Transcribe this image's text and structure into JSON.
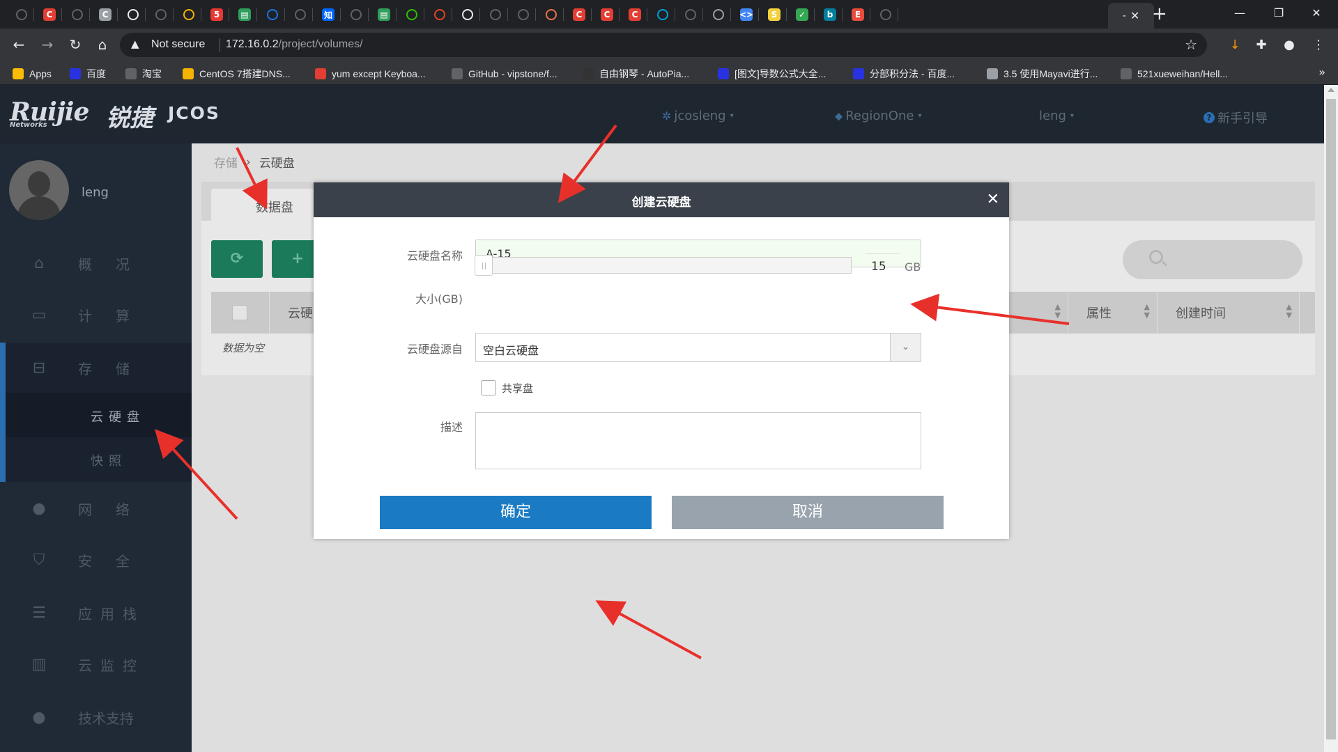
{
  "browser": {
    "tabs": [
      {
        "icon": "globe-icon",
        "color": "#5f6368",
        "glyph": ""
      },
      {
        "icon": "csdn-icon",
        "color": "#e33e33",
        "glyph": "C"
      },
      {
        "icon": "globe-icon",
        "color": "#5f6368",
        "glyph": ""
      },
      {
        "icon": "c-gray-icon",
        "color": "#9aa0a6",
        "glyph": "C"
      },
      {
        "icon": "puzzle-icon",
        "color": "#e8eaed",
        "glyph": ""
      },
      {
        "icon": "globe-icon",
        "color": "#5f6368",
        "glyph": ""
      },
      {
        "icon": "emoji-icon",
        "color": "#f4b400",
        "glyph": ""
      },
      {
        "icon": "five-icon",
        "color": "#e53935",
        "glyph": "5"
      },
      {
        "icon": "gitee-icon",
        "color": "#2e9e5b",
        "glyph": "▤"
      },
      {
        "icon": "search-icon",
        "color": "#1a73e8",
        "glyph": ""
      },
      {
        "icon": "github-icon",
        "color": "#5f6368",
        "glyph": ""
      },
      {
        "icon": "zhihu-icon",
        "color": "#0066ff",
        "glyph": "知"
      },
      {
        "icon": "github-icon",
        "color": "#5f6368",
        "glyph": ""
      },
      {
        "icon": "gitee-icon",
        "color": "#2e9e5b",
        "glyph": "▤"
      },
      {
        "icon": "wechat-icon",
        "color": "#2dc100",
        "glyph": ""
      },
      {
        "icon": "gitlab-icon",
        "color": "#e24329",
        "glyph": ""
      },
      {
        "icon": "panda-icon",
        "color": "#e8eaed",
        "glyph": ""
      },
      {
        "icon": "github-icon",
        "color": "#5f6368",
        "glyph": ""
      },
      {
        "icon": "globe-icon",
        "color": "#5f6368",
        "glyph": ""
      },
      {
        "icon": "fox-icon",
        "color": "#e8734a",
        "glyph": ""
      },
      {
        "icon": "csdn-icon",
        "color": "#e33e33",
        "glyph": "C"
      },
      {
        "icon": "csdn-icon",
        "color": "#e33e33",
        "glyph": "C"
      },
      {
        "icon": "csdn-icon",
        "color": "#e33e33",
        "glyph": "C"
      },
      {
        "icon": "bilibili-icon",
        "color": "#00a1d6",
        "glyph": ""
      },
      {
        "icon": "globe-icon",
        "color": "#5f6368",
        "glyph": ""
      },
      {
        "icon": "settings-icon",
        "color": "#9aa0a6",
        "glyph": ""
      },
      {
        "icon": "code-icon",
        "color": "#4285f4",
        "glyph": "<>"
      },
      {
        "icon": "s-yellow-icon",
        "color": "#f4d03f",
        "glyph": "S"
      },
      {
        "icon": "check-icon",
        "color": "#34a853",
        "glyph": "✓"
      },
      {
        "icon": "bing-icon",
        "color": "#00809d",
        "glyph": "b"
      },
      {
        "icon": "e-icon",
        "color": "#e74c3c",
        "glyph": "E"
      },
      {
        "icon": "github-icon",
        "color": "#5f6368",
        "glyph": ""
      }
    ],
    "active_tab_label": "-",
    "address": {
      "security": "Not secure",
      "host": "172.16.0.2",
      "path": "/project/volumes/"
    },
    "bookmarks": [
      {
        "label": "Apps",
        "icon": "apps-icon",
        "color": "#fbbc04"
      },
      {
        "label": "百度",
        "icon": "baidu-icon",
        "color": "#2932e1"
      },
      {
        "label": "淘宝",
        "icon": "globe-icon",
        "color": "#5f6368"
      },
      {
        "label": "CentOS 7搭建DNS...",
        "icon": "centos-icon",
        "color": "#f4b400"
      },
      {
        "label": "yum except Keyboa...",
        "icon": "csdn-icon",
        "color": "#e33e33"
      },
      {
        "label": "GitHub - vipstone/f...",
        "icon": "github-icon",
        "color": "#5f6368"
      },
      {
        "label": "自由钢琴 - AutoPia...",
        "icon": "piano-icon",
        "color": "#333333"
      },
      {
        "label": "[图文]导数公式大全...",
        "icon": "baidu-icon",
        "color": "#2932e1"
      },
      {
        "label": "分部积分法 - 百度...",
        "icon": "baidu-icon",
        "color": "#2932e1"
      },
      {
        "label": "3.5 使用Mayavi进行...",
        "icon": "book-icon",
        "color": "#9aa0a6"
      },
      {
        "label": "521xueweihan/Hell...",
        "icon": "github-icon",
        "color": "#5f6368"
      }
    ]
  },
  "app": {
    "logo": {
      "brand": "Ruijie",
      "sub": "Networks",
      "cn": "锐捷",
      "product": "JCOS"
    },
    "header": {
      "project": "jcosleng",
      "region": "RegionOne",
      "user": "leng",
      "help": "新手引导"
    },
    "sidebar": {
      "username": "leng",
      "items": [
        {
          "label": "概况",
          "icon": "home-icon"
        },
        {
          "label": "计算",
          "icon": "monitor-icon"
        },
        {
          "label": "存储",
          "icon": "hdd-icon"
        },
        {
          "label": "网络",
          "icon": "globe-icon"
        },
        {
          "label": "安全",
          "icon": "shield-icon"
        },
        {
          "label": "应用栈",
          "icon": "stack-icon"
        },
        {
          "label": "云监控",
          "icon": "bar-chart-icon"
        },
        {
          "label": "技术支持",
          "icon": "chat-icon"
        }
      ],
      "sub_items": [
        {
          "label": "云硬盘"
        },
        {
          "label": "快照"
        }
      ]
    },
    "breadcrumb": {
      "parent": "存储",
      "current": "云硬盘"
    },
    "panel": {
      "tab": "数据盘",
      "columns": [
        "云硬",
        "属性",
        "创建时间"
      ],
      "empty": "数据为空"
    },
    "modal": {
      "title": "创建云硬盘",
      "name_label": "云硬盘名称",
      "name_value": "A-15",
      "size_label": "大小(GB)",
      "size_value": "15",
      "size_unit": "GB",
      "size_fraction": 0,
      "source_label": "云硬盘源自",
      "source_value": "空白云硬盘",
      "share_label": "共享盘",
      "desc_label": "描述",
      "desc_value": "",
      "confirm": "确定",
      "cancel": "取消"
    }
  }
}
